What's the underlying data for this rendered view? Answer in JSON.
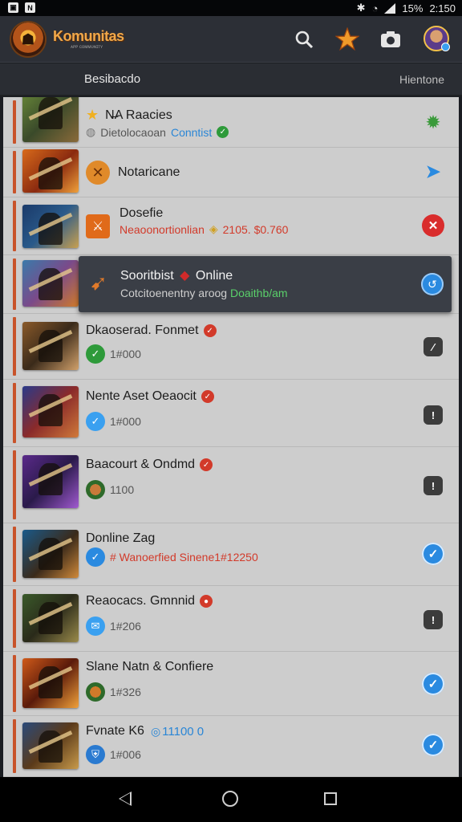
{
  "status_bar": {
    "battery": "15%",
    "time": "2:150",
    "left_icons": [
      "notification-icon",
      "notification-icon"
    ],
    "right_icons": [
      "bluetooth-icon",
      "wifi-icon",
      "signal-icon"
    ]
  },
  "app_bar": {
    "title": "Komunitas",
    "subtitle": "ᴀᴘᴘ ᴄᴏᴍᴍᴜɴɪᴛʏ",
    "icons": [
      "search-icon",
      "star-icon",
      "camera-icon",
      "avatar"
    ],
    "accent": "#f0a84a"
  },
  "tabs": {
    "left": "Besibacdo",
    "right": "Hientone"
  },
  "rows": [
    {
      "title": "N̶A  Raacies",
      "sub_prefix": "Dietolocaoan",
      "sub_link": "Conntist",
      "badge": "star",
      "action": "gear"
    },
    {
      "title": "Notaricane",
      "action": "send"
    },
    {
      "title": "Dosefie",
      "sub": "Neaoonortionlian",
      "sub_value": "2105. $0.760",
      "action": "close"
    },
    {
      "title": "Sooritbist",
      "title_suffix": "Online",
      "sub_prefix": "Cotcitoenentny aroog",
      "sub_link": "Doaithb/am",
      "action": "check"
    },
    {
      "title": "Dkaoserad. Fonmet",
      "meta": "1#000",
      "action": "square"
    },
    {
      "title": "Nente Aset Oeaocit",
      "meta": "1#000",
      "action": "square"
    },
    {
      "title": "Baacourt & Ondmd",
      "meta": "1100",
      "action": "square"
    },
    {
      "title": "Donline Zag",
      "sub": "# Wanoerfied Sinene1#12250",
      "action": "check"
    },
    {
      "title": "Reaocacs. Gmnnid",
      "meta": "1#206",
      "action": "square"
    },
    {
      "title": "Slane Natn & Confiere",
      "meta": "1#326",
      "action": "check"
    },
    {
      "title": "Fvnate K6",
      "title_suffix": "11100 0",
      "meta": "1#006",
      "action": "check"
    }
  ],
  "colors": {
    "accent_orange": "#c8532a",
    "blue": "#2a8ae0",
    "red": "#d92c2c",
    "list_bg": "#cdcdcd",
    "appbar_bg": "#2c2f36"
  }
}
